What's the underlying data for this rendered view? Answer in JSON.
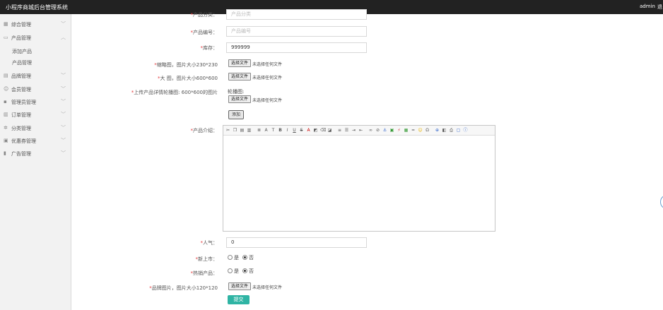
{
  "header": {
    "title": "小程序商城后台管理系统",
    "user": "admin",
    "more": "退"
  },
  "sidebar": {
    "items": [
      {
        "label": "综合管理",
        "icon": "grid-icon"
      },
      {
        "label": "产品管理",
        "icon": "box-icon",
        "children": [
          "添加产品",
          "产品管理"
        ]
      },
      {
        "label": "品牌管理",
        "icon": "tag-icon"
      },
      {
        "label": "会员管理",
        "icon": "user-icon"
      },
      {
        "label": "管理员管理",
        "icon": "admin-icon"
      },
      {
        "label": "订单管理",
        "icon": "order-icon"
      },
      {
        "label": "分类管理",
        "icon": "category-icon"
      },
      {
        "label": "优惠券管理",
        "icon": "coupon-icon"
      },
      {
        "label": "广告管理",
        "icon": "ad-icon"
      }
    ]
  },
  "form": {
    "category": {
      "label": "产品分类：",
      "placeholder": "产品分类"
    },
    "code": {
      "label": "产品编号：",
      "placeholder": "产品编号"
    },
    "stock": {
      "label": "库存：",
      "value": "999999"
    },
    "thumb": {
      "label": "缩略图，图片大小230*230"
    },
    "large": {
      "label": "大 图，图片大小600*600"
    },
    "carousel": {
      "label": "上传产品详情轮播图: 600*600的图片",
      "sublabel": "轮播图:"
    },
    "file_button": "选择文件",
    "file_note": "未选择任何文件",
    "add_button": "添加",
    "intro": {
      "label": "产品介绍："
    },
    "popularity": {
      "label": "人气：",
      "value": "0"
    },
    "new_arrival": {
      "label": "新上市：",
      "yes": "是",
      "no": "否",
      "selected": "否"
    },
    "hot": {
      "label": "热销产品：",
      "yes": "是",
      "no": "否",
      "selected": "否"
    },
    "brand_image": {
      "label": "品牌图片，图片大小120*120"
    },
    "submit": "提交"
  }
}
